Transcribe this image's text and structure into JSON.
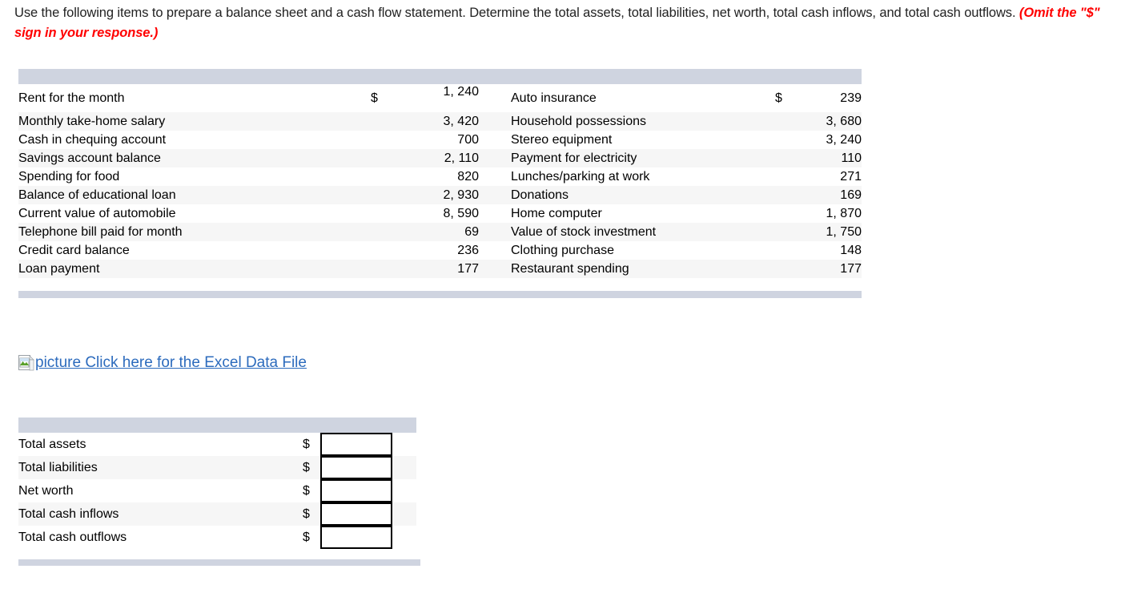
{
  "prompt": {
    "text_part1": "Use the following items to prepare a balance sheet and a cash flow statement. Determine the total assets, total liabilities, net worth, total cash inflows, and total cash outflows. ",
    "omit_note": "(Omit the \"$\" sign in your response.)"
  },
  "items_table": {
    "currency_symbol": "$",
    "left_column": [
      {
        "label": "Rent for the month",
        "value": "1, 240"
      },
      {
        "label": "Monthly take-home salary",
        "value": "3, 420"
      },
      {
        "label": "Cash in chequing account",
        "value": "700"
      },
      {
        "label": "Savings account balance",
        "value": "2, 110"
      },
      {
        "label": "Spending for food",
        "value": "820"
      },
      {
        "label": "Balance of educational loan",
        "value": "2, 930"
      },
      {
        "label": "Current value of automobile",
        "value": "8, 590"
      },
      {
        "label": "Telephone bill paid for month",
        "value": "69"
      },
      {
        "label": "Credit card balance",
        "value": "236"
      },
      {
        "label": "Loan payment",
        "value": "177"
      }
    ],
    "right_column": [
      {
        "label": "Auto insurance",
        "value": "239"
      },
      {
        "label": "Household possessions",
        "value": "3, 680"
      },
      {
        "label": "Stereo equipment",
        "value": "3, 240"
      },
      {
        "label": "Payment for electricity",
        "value": "110"
      },
      {
        "label": "Lunches/parking at work",
        "value": "271"
      },
      {
        "label": "Donations",
        "value": "169"
      },
      {
        "label": "Home computer",
        "value": "1, 870"
      },
      {
        "label": "Value of stock investment",
        "value": "1, 750"
      },
      {
        "label": "Clothing purchase",
        "value": "148"
      },
      {
        "label": "Restaurant spending",
        "value": "177"
      }
    ]
  },
  "excel_link": {
    "icon_alt": "picture",
    "label": "Click here for the Excel Data File",
    "color": "#2c6bbd"
  },
  "answer_table": {
    "currency_symbol": "$",
    "rows": [
      {
        "label": "Total assets",
        "value": "",
        "placeholder": ""
      },
      {
        "label": "Total liabilities",
        "value": "",
        "placeholder": ""
      },
      {
        "label": "Net worth",
        "value": "",
        "placeholder": ""
      },
      {
        "label": "Total cash inflows",
        "value": "",
        "placeholder": ""
      },
      {
        "label": "Total cash outflows",
        "value": "",
        "placeholder": ""
      }
    ]
  },
  "colors": {
    "band": "#cfd4e0",
    "stripe": "#f6f6f6",
    "link": "#2c6bbd",
    "warning": "#ff0000",
    "text": "#333333"
  }
}
